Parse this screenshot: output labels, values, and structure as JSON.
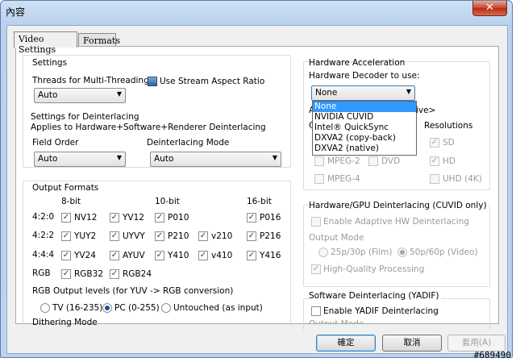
{
  "window": {
    "title": "內容",
    "close": "✕"
  },
  "tabs": [
    "Video Settings",
    "Formats"
  ],
  "settings": {
    "heading": "Settings",
    "threads_label": "Threads for Multi-Threading",
    "threads_value": "Auto",
    "stream_aspect_label": "Use Stream Aspect Ratio",
    "deint_heading": "Settings for Deinterlacing",
    "deint_sub": "Applies to Hardware+Software+Renderer Deinterlacing",
    "field_order_label": "Field Order",
    "field_order_value": "Auto",
    "deint_mode_label": "Deinterlacing Mode",
    "deint_mode_value": "Auto"
  },
  "output": {
    "heading": "Output Formats",
    "col_8": "8-bit",
    "col_10": "10-bit",
    "col_16": "16-bit",
    "rows": {
      "r420": "4:2:0",
      "r422": "4:2:2",
      "r444": "4:4:4",
      "rgb": "RGB"
    },
    "items": {
      "nv12": "NV12",
      "yv12": "YV12",
      "p010": "P010",
      "p016": "P016",
      "yuy2": "YUY2",
      "uyvy": "UYVY",
      "p210": "P210",
      "v210": "v210",
      "p216": "P216",
      "yv24": "YV24",
      "ayuv": "AYUV",
      "y410": "Y410",
      "v410": "v410",
      "y416": "Y416",
      "rgb32": "RGB32",
      "rgb24": "RGB24"
    },
    "levels_label": "RGB Output levels (for YUV -> RGB conversion)",
    "levels": [
      "TV (16-235)",
      "PC (0-255)",
      "Untouched (as input)"
    ],
    "dither_label": "Dithering Mode"
  },
  "hw": {
    "heading": "Hardware Acceleration",
    "decoder_label": "Hardware Decoder to use:",
    "decoder_value": "None",
    "options": [
      "None",
      "NVIDIA CUVID",
      "Intel® QuickSync",
      "DXVA2 (copy-back)",
      "DXVA2 (native)"
    ],
    "hidden_a": "A",
    "hidden_c": "C",
    "hidden_tail": "ive>",
    "resolutions_label": "Resolutions",
    "sd": "SD",
    "hd": "HD",
    "uhd": "UHD (4K)",
    "mpeg2": "MPEG-2",
    "dvd": "DVD",
    "mpeg4": "MPEG-4"
  },
  "hwdeint": {
    "heading": "Hardware/GPU Deinterlacing (CUVID only)",
    "adaptive": "Enable Adaptive HW Deinterlacing",
    "output_mode": "Output Mode",
    "film": "25p/30p (Film)",
    "video": "50p/60p (Video)",
    "hq": "High-Quality Processing"
  },
  "swdeint": {
    "heading": "Software Deinterlacing (YADIF)",
    "enable": "Enable YADIF Deinterlacing",
    "output_mode": "Output Mode"
  },
  "buttons": {
    "ok": "確定",
    "cancel": "取消",
    "apply": "套用(A)"
  },
  "watermark": "#689490"
}
